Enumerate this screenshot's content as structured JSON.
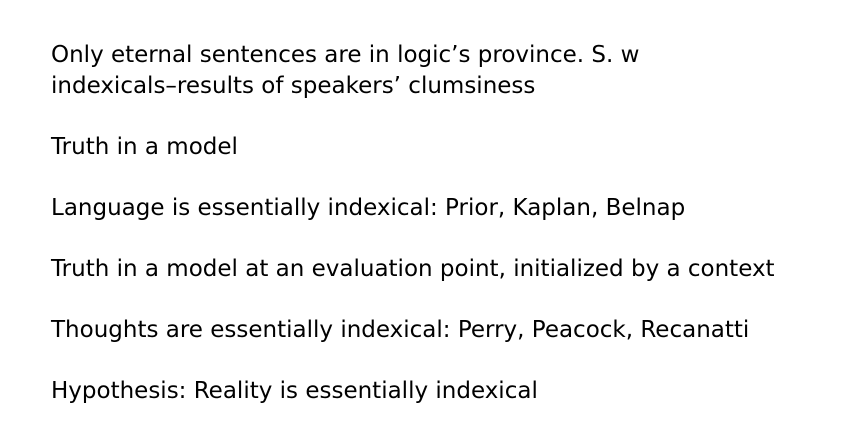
{
  "slide": {
    "paragraphs": [
      {
        "lines": [
          "Only eternal sentences are in logic’s province. S. w",
          "indexicals–results of speakers’ clumsiness"
        ]
      },
      {
        "lines": [
          "Truth in a model"
        ]
      },
      {
        "lines": [
          "Language is essentially indexical: Prior, Kaplan, Belnap"
        ]
      },
      {
        "lines": [
          "Truth in a model at an evaluation point, initialized by a context"
        ]
      },
      {
        "lines": [
          "Thoughts are essentially indexical: Perry, Peacock, Recanatti"
        ]
      },
      {
        "lines": [
          "Hypothesis: Reality is essentially indexical"
        ]
      }
    ]
  }
}
